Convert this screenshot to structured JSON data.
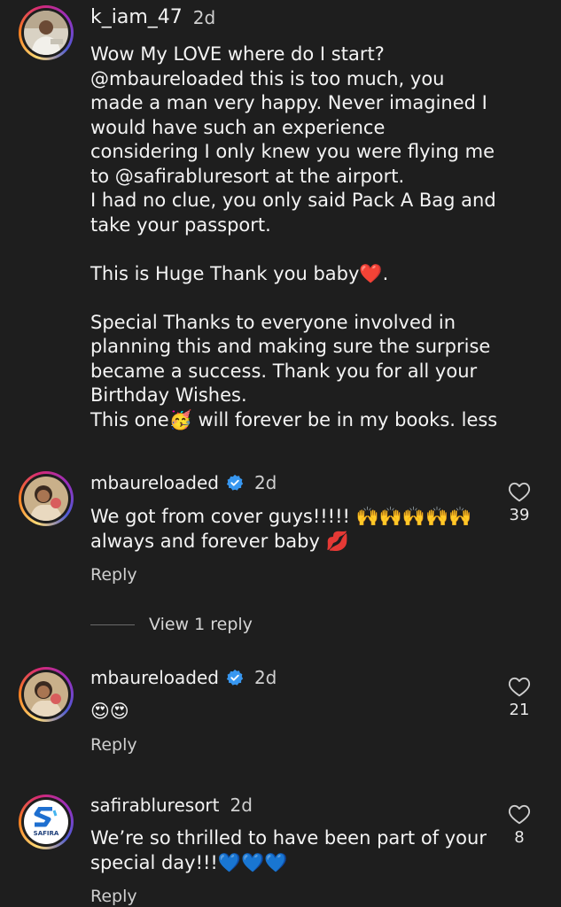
{
  "comments": [
    {
      "username": "k_iam_47",
      "time": "2d",
      "text": "Wow My LOVE where do I start? @mbaureloaded this is too much, you made a man very happy. Never imagined I would have such an experience considering I only knew you were flying me to @safirabluresort at the airport.\nI had no clue, you only said Pack A Bag and take your passport.\n\nThis is Huge Thank you baby❤️.\n\nSpecial Thanks to everyone involved in planning this and making sure the surprise became a success. Thank you for all your Birthday Wishes.\nThis one🥳 will forever be in my books. less"
    },
    {
      "username": "mbaureloaded",
      "time": "2d",
      "text": "We got from cover guys!!!!! 🙌🙌🙌🙌🙌 always and forever baby 💋",
      "reply_label": "Reply",
      "likes": "39",
      "view_replies": "View 1 reply"
    },
    {
      "username": "mbaureloaded",
      "time": "2d",
      "text": "😍😍",
      "reply_label": "Reply",
      "likes": "21"
    },
    {
      "username": "safirabluresort",
      "time": "2d",
      "text": "We’re so thrilled to have been part of your special day!!!💙💙💙",
      "reply_label": "Reply",
      "likes": "8",
      "avatar_logo_text": "SAFIRA"
    }
  ],
  "colors": {
    "background": "#1e1e1e",
    "verified": "#3897f0",
    "heart": "#e8202f"
  },
  "icons": {
    "like": "heart-outline-icon",
    "verified": "verified-badge-icon"
  }
}
